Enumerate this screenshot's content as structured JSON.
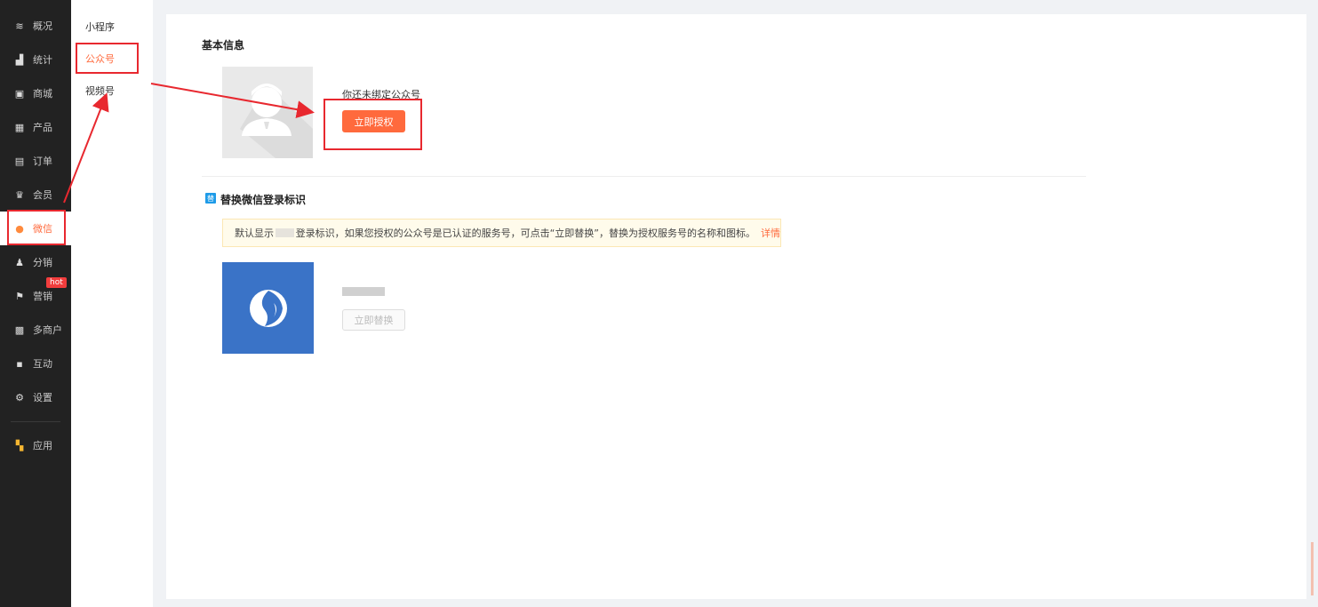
{
  "nav": {
    "items": [
      {
        "label": "概况",
        "icon": "layers-icon",
        "glyph": "≋"
      },
      {
        "label": "统计",
        "icon": "chart-icon",
        "glyph": "▟"
      },
      {
        "label": "商城",
        "icon": "shop-icon",
        "glyph": "▣"
      },
      {
        "label": "产品",
        "icon": "grid-icon",
        "glyph": "▦"
      },
      {
        "label": "订单",
        "icon": "clipboard-icon",
        "glyph": "▤"
      },
      {
        "label": "会员",
        "icon": "crown-icon",
        "glyph": "♛"
      },
      {
        "label": "微信",
        "icon": "wechat-icon",
        "glyph": "●"
      },
      {
        "label": "分销",
        "icon": "users-icon",
        "glyph": "♟"
      },
      {
        "label": "营销",
        "icon": "flag-icon",
        "glyph": "⚑"
      },
      {
        "label": "多商户",
        "icon": "store-icon",
        "glyph": "▩"
      },
      {
        "label": "互动",
        "icon": "apps-icon",
        "glyph": "▪"
      },
      {
        "label": "设置",
        "icon": "gear-icon",
        "glyph": "⚙"
      },
      {
        "label": "应用",
        "icon": "app-grid-icon",
        "glyph": "▚"
      }
    ],
    "active": "微信",
    "hot_badge": "hot"
  },
  "subnav": {
    "items": [
      "小程序",
      "公众号",
      "视频号"
    ],
    "active": "公众号"
  },
  "basic_info": {
    "title": "基本信息",
    "unbound_text": "你还未绑定公众号",
    "authorize_button": "立即授权"
  },
  "replace_section": {
    "title": "替换微信登录标识",
    "icon_glyph": "替",
    "notice_prefix": "默认显示",
    "notice_body": "登录标识，如果您授权的公众号是已认证的服务号，可点击“立即替换”，替换为授权服务号的名称和图标。",
    "notice_link": "详情",
    "replace_button": "立即替换"
  },
  "colors": {
    "accent": "#ff6a3d",
    "annotation_red": "#e8282f",
    "logo_blue": "#3a73c7",
    "nav_bg": "#222222"
  }
}
